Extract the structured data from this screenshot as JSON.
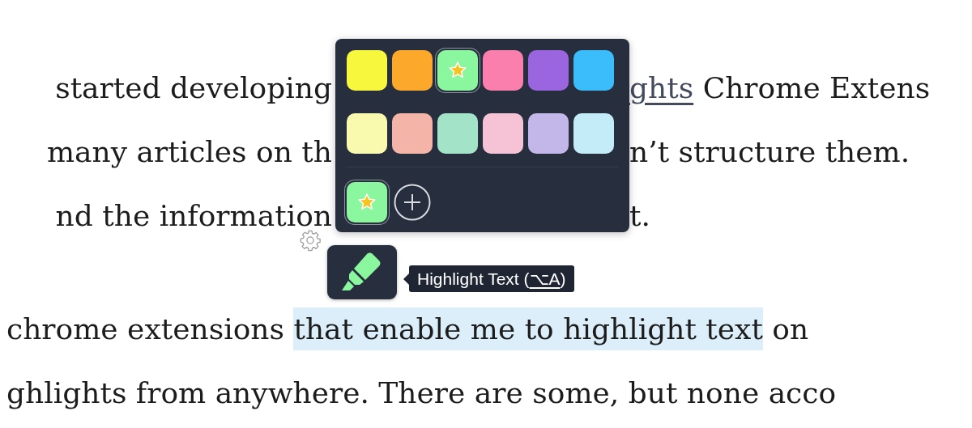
{
  "article": {
    "paragraphs": [
      {
        "lines": [
          {
            "kind": "split",
            "segments": [
              {
                "kind": "plain",
                "text": "started developing"
              },
              {
                "kind": "link",
                "text": "ghts"
              },
              {
                "kind": "plain",
                "text": "Chrome Extens"
              }
            ]
          },
          {
            "kind": "split",
            "segments": [
              {
                "kind": "plain",
                "text": "many articles on th"
              },
              {
                "kind": "plain",
                "text": "n’t structure them."
              }
            ]
          },
          {
            "kind": "split",
            "segments": [
              {
                "kind": "plain",
                "text": "nd the information"
              },
              {
                "kind": "plain",
                "text": "t."
              }
            ]
          }
        ]
      },
      {
        "lines": [
          {
            "kind": "full",
            "segments": [
              {
                "kind": "plain",
                "text": "chrome extensions"
              },
              {
                "kind": "highlight",
                "text": "that enable me to highlight text"
              },
              {
                "kind": "plain",
                "text": "on"
              }
            ]
          },
          {
            "kind": "full",
            "segments": [
              {
                "kind": "plain",
                "text": "ghlights from anywhere. There are some, but none acco"
              }
            ]
          }
        ]
      }
    ]
  },
  "palette": {
    "swatches": [
      {
        "color": "#f7f73d",
        "selected": false
      },
      {
        "color": "#fca82a",
        "selected": false
      },
      {
        "color": "#8af79e",
        "selected": true
      },
      {
        "color": "#fb7fad",
        "selected": false
      },
      {
        "color": "#9b65e0",
        "selected": false
      },
      {
        "color": "#3bbdfc",
        "selected": false
      },
      {
        "color": "#fafaaf",
        "selected": false
      },
      {
        "color": "#f5b4a8",
        "selected": false
      },
      {
        "color": "#a3e3c8",
        "selected": false
      },
      {
        "color": "#f6c3d6",
        "selected": false
      },
      {
        "color": "#c3b7ea",
        "selected": false
      },
      {
        "color": "#c4ecf8",
        "selected": false
      }
    ],
    "custom": [
      {
        "color": "#8af79e",
        "selected": true
      }
    ]
  },
  "tooltip": {
    "text_before": "Highlight Text (",
    "shortcut": "⌥A",
    "text_after": ")"
  }
}
